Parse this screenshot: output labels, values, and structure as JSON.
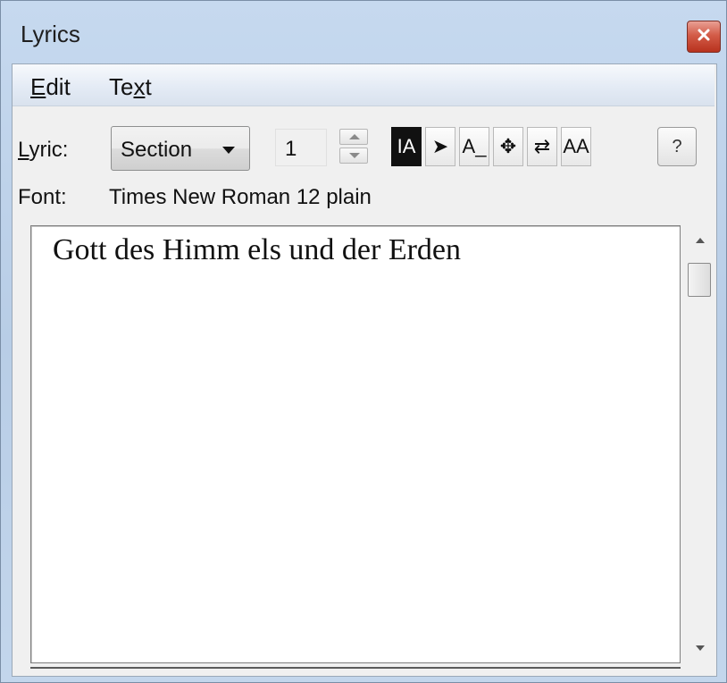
{
  "window": {
    "title": "Lyrics",
    "close_icon": "close-icon"
  },
  "menu": {
    "items": [
      {
        "pre": "",
        "mnemonic": "E",
        "post": "dit"
      },
      {
        "pre": "Te",
        "mnemonic": "x",
        "post": "t"
      }
    ]
  },
  "toolbar": {
    "lyric_label_mnemonic": "L",
    "lyric_label_rest": "yric:",
    "lyric_type_selected": "Section",
    "lyric_number": "1",
    "tools": [
      {
        "icon": "text-cursor-icon",
        "glyph": "IA",
        "active": true
      },
      {
        "icon": "pointer-arrow-icon",
        "glyph": "➤",
        "active": false
      },
      {
        "icon": "underscore-text-icon",
        "glyph": "A_",
        "active": false
      },
      {
        "icon": "move-icon",
        "glyph": "✥",
        "active": false
      },
      {
        "icon": "swap-arrows-icon",
        "glyph": "⇄",
        "active": false
      },
      {
        "icon": "font-size-icon",
        "glyph": "AA",
        "active": false
      }
    ],
    "help_label": "?"
  },
  "font": {
    "label": "Font:",
    "value": "Times New Roman  12 plain"
  },
  "editor": {
    "text": "Gott des Himm els und der Erden"
  },
  "colors": {
    "active_tool_bg": "#111111",
    "close_button": "#c9462f",
    "titlebar": "#c3d6ec"
  }
}
